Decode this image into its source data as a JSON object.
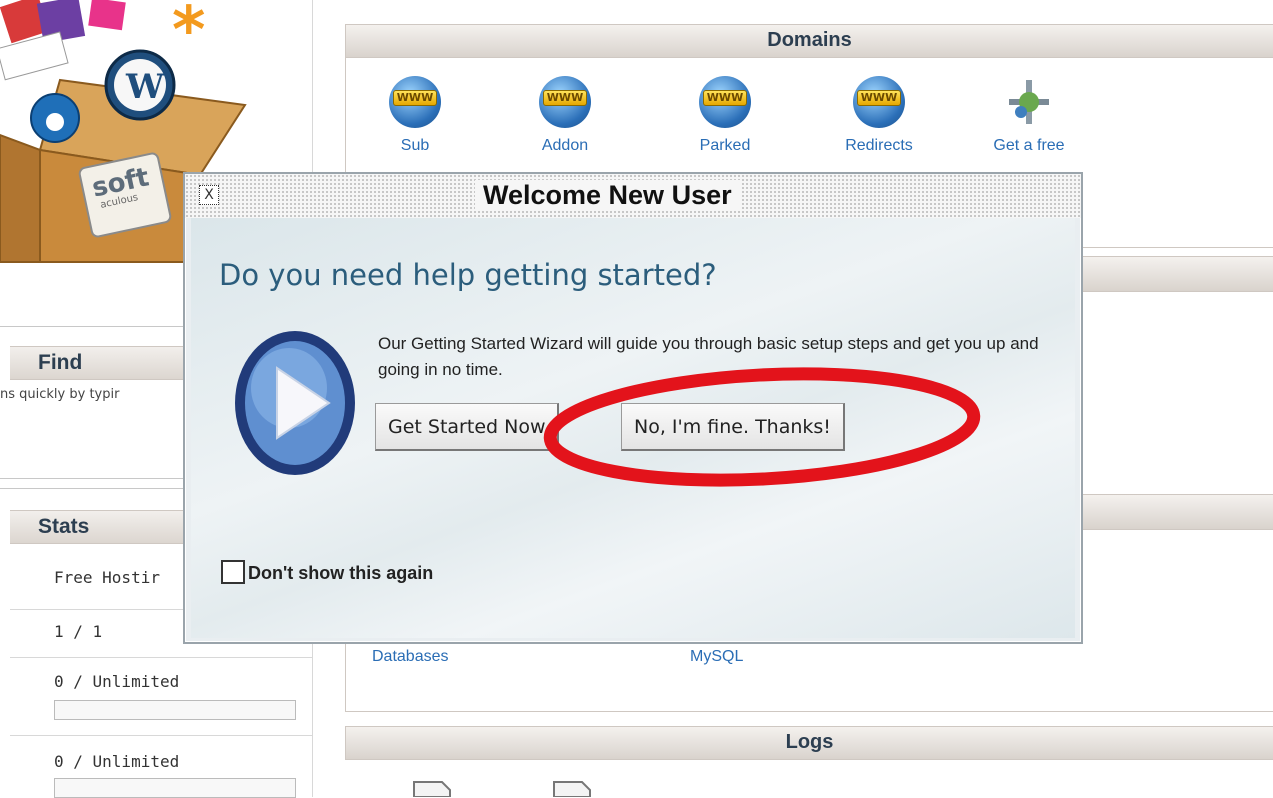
{
  "sidebar": {
    "logo_text": "soft",
    "logo_subtext": "aculous",
    "find_title": "Find",
    "find_hint": "ns quickly by typir",
    "stats_title": "Stats",
    "stats_rows": [
      {
        "value": "Free Hostir"
      },
      {
        "value": "1 / 1"
      },
      {
        "value": "0 / Unlimited"
      },
      {
        "value": "0 / Unlimited"
      }
    ]
  },
  "domains_panel": {
    "title": "Domains",
    "items": [
      {
        "label": "Sub",
        "icon": "subdomains-icon"
      },
      {
        "label": "Addon",
        "icon": "addon-domains-icon"
      },
      {
        "label": "Parked",
        "icon": "parked-domains-icon"
      },
      {
        "label": "Redirects",
        "icon": "redirects-icon"
      },
      {
        "label": "Get a free",
        "icon": "free-domain-icon"
      }
    ],
    "www_tag": "WWW"
  },
  "databases_panel": {
    "links": [
      "Databases",
      "MySQL"
    ]
  },
  "logs_panel": {
    "title": "Logs"
  },
  "modal": {
    "title": "Welcome New User",
    "close_label": "X",
    "heading": "Do you need help getting started?",
    "description": "Our Getting Started Wizard will guide you through basic setup steps and get you up and going in no time.",
    "primary_button": "Get Started Now",
    "secondary_button": "No, I'm fine. Thanks!",
    "checkbox_label": "Don't show this again",
    "checkbox_checked": false
  },
  "annotation": {
    "color": "#e3131b",
    "shape": "ellipse"
  },
  "colors": {
    "link": "#2a6db5",
    "heading": "#2b5d7c",
    "panel_header": "#2c3e50"
  }
}
